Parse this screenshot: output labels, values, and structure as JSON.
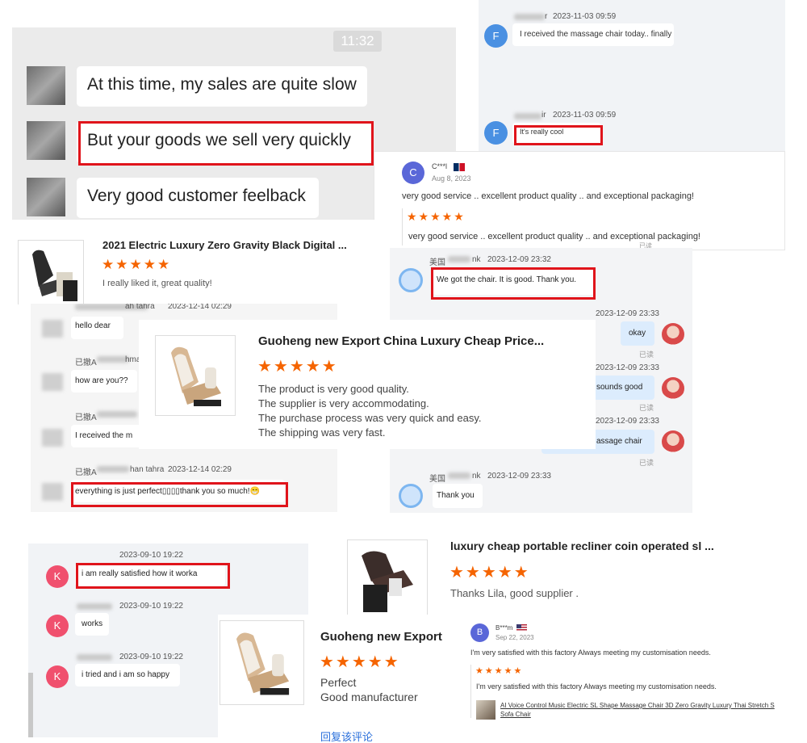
{
  "colors": {
    "accent_red": "#e0141b",
    "star_orange": "#f56400",
    "link_blue": "#2a6fdb",
    "avatar_blue": "#4a90e2",
    "avatar_pink": "#f0506e",
    "avatar_indigo": "#5a67d8"
  },
  "wechat_chat": {
    "time": "11:32",
    "messages": [
      "At this time, my sales are quite slow",
      "But your goods we sell very quickly",
      "Very good customer feelback"
    ]
  },
  "chat_f": {
    "messages": [
      {
        "sender_suffix": "r",
        "date": "2023-11-03 09:59",
        "avatar_letter": "F",
        "text": "I received the massage chair today.. finally"
      },
      {
        "sender_suffix": "ir",
        "date": "2023-11-03 09:59",
        "avatar_letter": "F",
        "text": "It's really cool"
      }
    ]
  },
  "review_c": {
    "avatar_letter": "C",
    "name": "C***l",
    "flag_icon": "flag-dominican-icon",
    "date": "Aug 8, 2023",
    "text_top": "very good service .. excellent product quality .. and exceptional packaging!",
    "stars": "★★★★★",
    "text": "very good service .. excellent product quality .. and exceptional packaging!",
    "bottom_mark": "已读"
  },
  "review_2021": {
    "product_name": "2021 Electric Luxury Zero Gravity Black Digital ...",
    "stars": "★★★★★",
    "comment": "I really liked it, great quality!"
  },
  "chat_right": {
    "messages": [
      {
        "sender": "美国",
        "sender_suffix": "nk",
        "date": "2023-12-09 23:32",
        "text": "We got the chair. It is good. Thank you.",
        "side": "left"
      },
      {
        "date": "2023-12-09 23:33",
        "text": "okay",
        "read": "已读",
        "side": "right"
      },
      {
        "date": "2023-12-09 23:33",
        "text": "sounds good",
        "read": "已读",
        "side": "right"
      },
      {
        "date": "2023-12-09 23:33",
        "text": "assage chair",
        "read": "已读",
        "side": "right"
      },
      {
        "sender": "美国",
        "sender_suffix": "nk",
        "date": "2023-12-09 23:33",
        "text": "Thank you",
        "side": "left"
      }
    ]
  },
  "chat_left": {
    "messages": [
      {
        "sender": "",
        "sender_suffix": "ah tahra",
        "date": "2023-12-14 02:29",
        "text": "hello dear"
      },
      {
        "sender": "已撤A",
        "sender_suffix": "hmai",
        "date": "",
        "text": "how are you??"
      },
      {
        "sender": "已撤A",
        "sender_suffix": "",
        "date": "",
        "text": "I received the m"
      },
      {
        "sender": "已撤A",
        "sender_suffix": "han tahra",
        "date": "2023-12-14 02:29",
        "text": "everything is just perfect▯▯▯▯thank you so much!😁"
      }
    ]
  },
  "review_guoheng_main": {
    "product_name": "Guoheng new Export China Luxury Cheap Price...",
    "stars": "★★★★★",
    "lines": [
      "The product is very good quality.",
      "The supplier is very accommodating.",
      "The purchase process was very quick and easy.",
      "The shipping was very fast."
    ]
  },
  "chat_k": {
    "messages": [
      {
        "date": "2023-09-10 19:22",
        "avatar_letter": "K",
        "text": "i am really satisfied how it worka"
      },
      {
        "date": "2023-09-10 19:22",
        "avatar_letter": "K",
        "text": "works"
      },
      {
        "date": "2023-09-10 19:22",
        "avatar_letter": "K",
        "text": "i tried and i am so happy"
      }
    ]
  },
  "review_luxury": {
    "product_name": "luxury cheap portable recliner coin operated sl ...",
    "stars": "★★★★★",
    "comment": "Thanks Lila, good supplier ."
  },
  "review_guoheng_small": {
    "product_name": "Guoheng new Export",
    "stars": "★★★★★",
    "lines": [
      "Perfect",
      "Good manufacturer"
    ],
    "reply_link": "回复该评论"
  },
  "review_b": {
    "avatar_letter": "B",
    "name": "B***m",
    "flag_icon": "flag-usa-icon",
    "date": "Sep 22, 2023",
    "text_top": "I'm very satisfied with this factory Always meeting my customisation needs.",
    "stars": "★★★★★",
    "text": "I'm very satisfied with this factory Always meeting my customisation needs.",
    "product_line1": "AI Voice Control Music Electric SL Shape Massage Chair 3D Zero Gravity Luxury Thai Stretch S",
    "product_line2": "Sofa Chair"
  }
}
